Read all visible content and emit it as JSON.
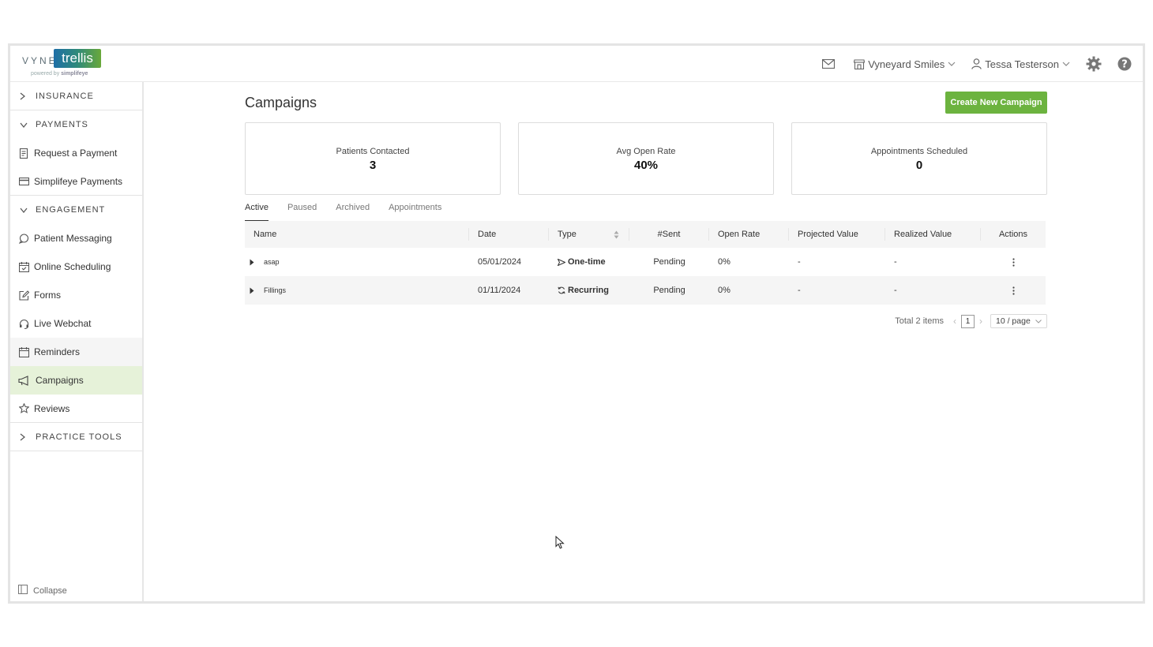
{
  "brand": {
    "vyne": "VYNE",
    "trellis": "trellis",
    "powered_by": "powered by",
    "simplifeye": "simplifeye"
  },
  "header": {
    "mail_icon": "mail-icon",
    "practice": "Vyneyard Smiles",
    "user": "Tessa Testerson",
    "settings_icon": "gear-icon",
    "help_icon": "help-icon"
  },
  "sidebar": {
    "sections": [
      {
        "label": "INSURANCE",
        "expanded": false
      },
      {
        "label": "PAYMENTS",
        "expanded": true
      },
      {
        "label": "ENGAGEMENT",
        "expanded": true
      },
      {
        "label": "PRACTICE TOOLS",
        "expanded": false
      }
    ],
    "payments_items": [
      {
        "label": "Request a Payment",
        "icon": "receipt-icon"
      },
      {
        "label": "Simplifeye Payments",
        "icon": "card-icon"
      }
    ],
    "engagement_items": [
      {
        "label": "Patient Messaging",
        "icon": "chat-icon"
      },
      {
        "label": "Online Scheduling",
        "icon": "calendar-check-icon"
      },
      {
        "label": "Forms",
        "icon": "edit-icon"
      },
      {
        "label": "Live Webchat",
        "icon": "headset-icon"
      },
      {
        "label": "Reminders",
        "icon": "calendar-icon"
      },
      {
        "label": "Campaigns",
        "icon": "megaphone-icon",
        "active": true
      },
      {
        "label": "Reviews",
        "icon": "star-icon"
      }
    ],
    "collapse": "Collapse"
  },
  "main": {
    "title": "Campaigns",
    "create_button": "Create New Campaign",
    "stats": [
      {
        "label": "Patients Contacted",
        "value": "3"
      },
      {
        "label": "Avg Open Rate",
        "value": "40%"
      },
      {
        "label": "Appointments Scheduled",
        "value": "0"
      }
    ],
    "tabs": [
      "Active",
      "Paused",
      "Archived",
      "Appointments"
    ],
    "active_tab": "Active",
    "table": {
      "columns": [
        "Name",
        "Date",
        "Type",
        "#Sent",
        "Open Rate",
        "Projected Value",
        "Realized Value",
        "Actions"
      ],
      "rows": [
        {
          "name": "asap",
          "date": "05/01/2024",
          "type": "One-time",
          "type_icon": "send-icon",
          "sent": "Pending",
          "open_rate": "0%",
          "projected": "-",
          "realized": "-"
        },
        {
          "name": "Fillings",
          "date": "01/11/2024",
          "type": "Recurring",
          "type_icon": "recurring-icon",
          "sent": "Pending",
          "open_rate": "0%",
          "projected": "-",
          "realized": "-"
        }
      ]
    },
    "pagination": {
      "total": "Total 2 items",
      "current_page": "1",
      "page_size": "10 / page"
    }
  },
  "colors": {
    "accent_green": "#6cb33f",
    "active_nav_bg": "#e6f2d9",
    "header_bg": "#f5f5f5"
  }
}
